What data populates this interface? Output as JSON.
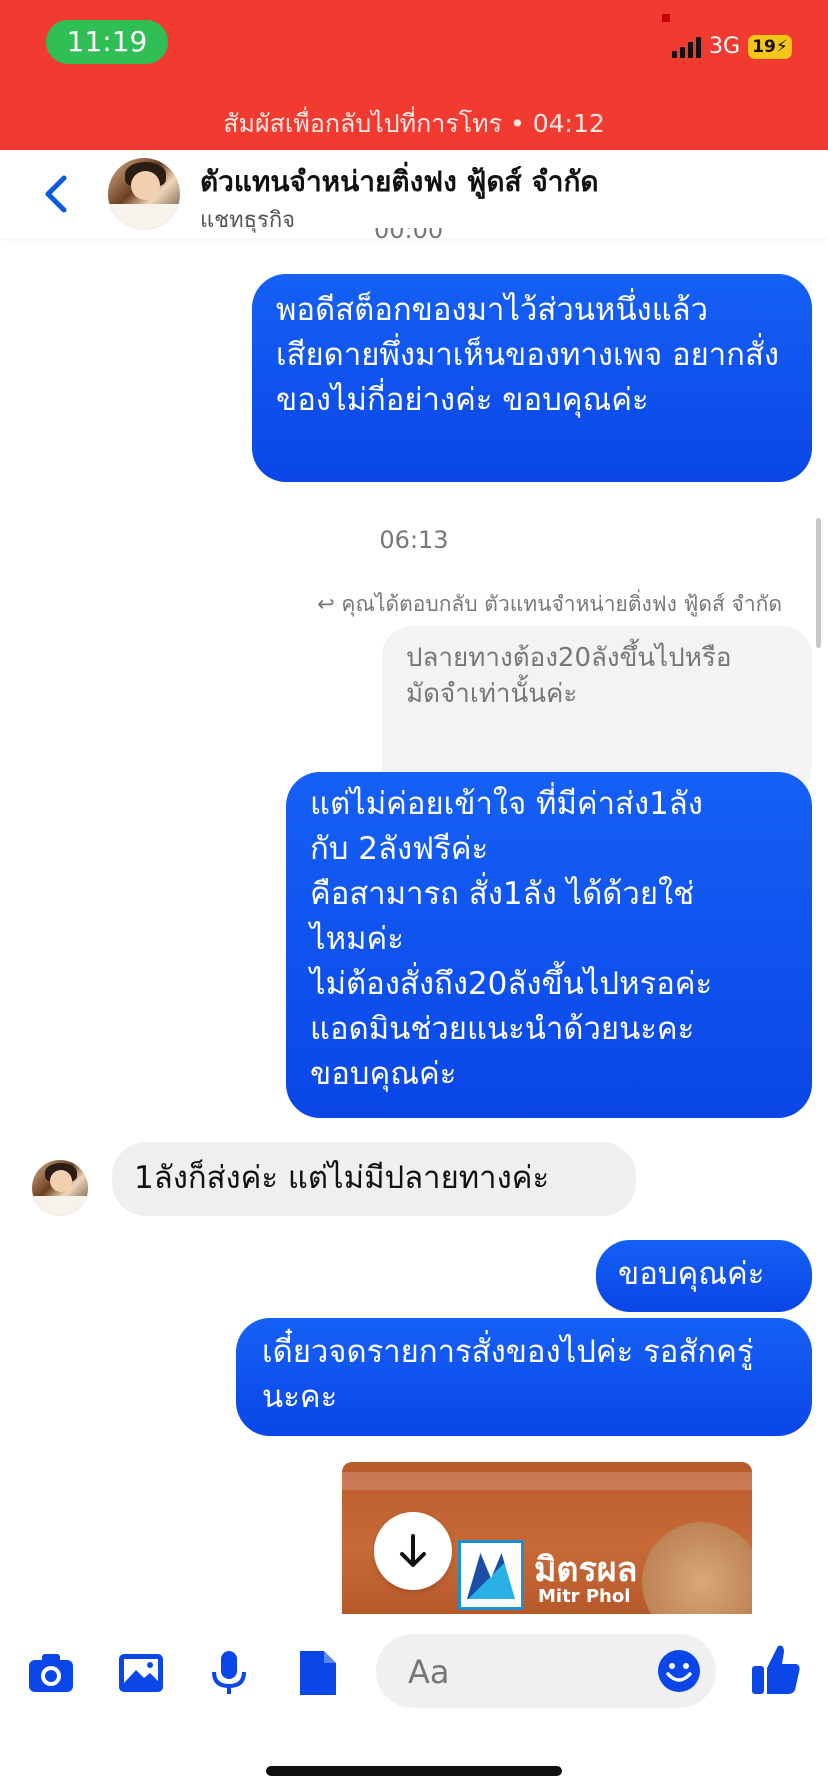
{
  "status_bar": {
    "time": "11:19",
    "network": "3G",
    "battery": "19"
  },
  "call_banner": {
    "text": "สัมผัสเพื่อกลับไปที่การโทร • 04:12"
  },
  "header": {
    "title": "ตัวแทนจำหน่ายติ่งฟง ฟู้ดส์ จำกัด",
    "subtitle": "แชทธุรกิจ"
  },
  "messages": {
    "m1": "พอดีสต็อกของมาไว้ส่วนหนึ่งแล้ว เสียดายพึ่งมาเห็นของทางเพจ อยากสั่งของไม่กี่อย่างค่ะ ขอบคุณค่ะ",
    "ts1": "06:13",
    "reply_note": "คุณได้ตอบกลับ ตัวแทนจำหน่ายติ่งฟง ฟู้ดส์ จำกัด",
    "quoted": "ปลายทางต้อง20ลังขึ้นไปหรือมัดจำเท่านั้นค่ะ",
    "m2_lines": [
      "แต่ไม่ค่อยเข้าใจ ที่มีค่าส่ง1ลัง",
      "กับ 2ลังฟรีค่ะ",
      "คือสามารถ สั่ง1ลัง ได้ด้วยใช่",
      "ไหมค่ะ",
      "ไม่ต้องสั่งถึง20ลังขึ้นไปหรอค่ะ",
      "แอดมินช่วยแนะนำด้วยนะคะ",
      "ขอบคุณค่ะ"
    ],
    "m3": "1ลังก็ส่งค่ะ แต่ไม่มีปลายทางค่ะ",
    "m4": "ขอบคุณค่ะ",
    "m5": "เดี๋ยวจดรายการสั่งของไปค่ะ รอสักครู่นะคะ"
  },
  "image_attachment": {
    "brand_th": "มิตรผล",
    "brand_en": "Mitr Phol",
    "download_icon": "arrow-down-icon"
  },
  "composer": {
    "placeholder": "Aa"
  },
  "icons": {
    "toolbar": [
      "camera-icon",
      "gallery-icon",
      "microphone-icon",
      "document-icon",
      "emoji-icon",
      "thumbs-up-icon"
    ]
  },
  "colors": {
    "banner": "#f23b30",
    "accent": "#0a46e8",
    "pill": "#2fbf55"
  }
}
